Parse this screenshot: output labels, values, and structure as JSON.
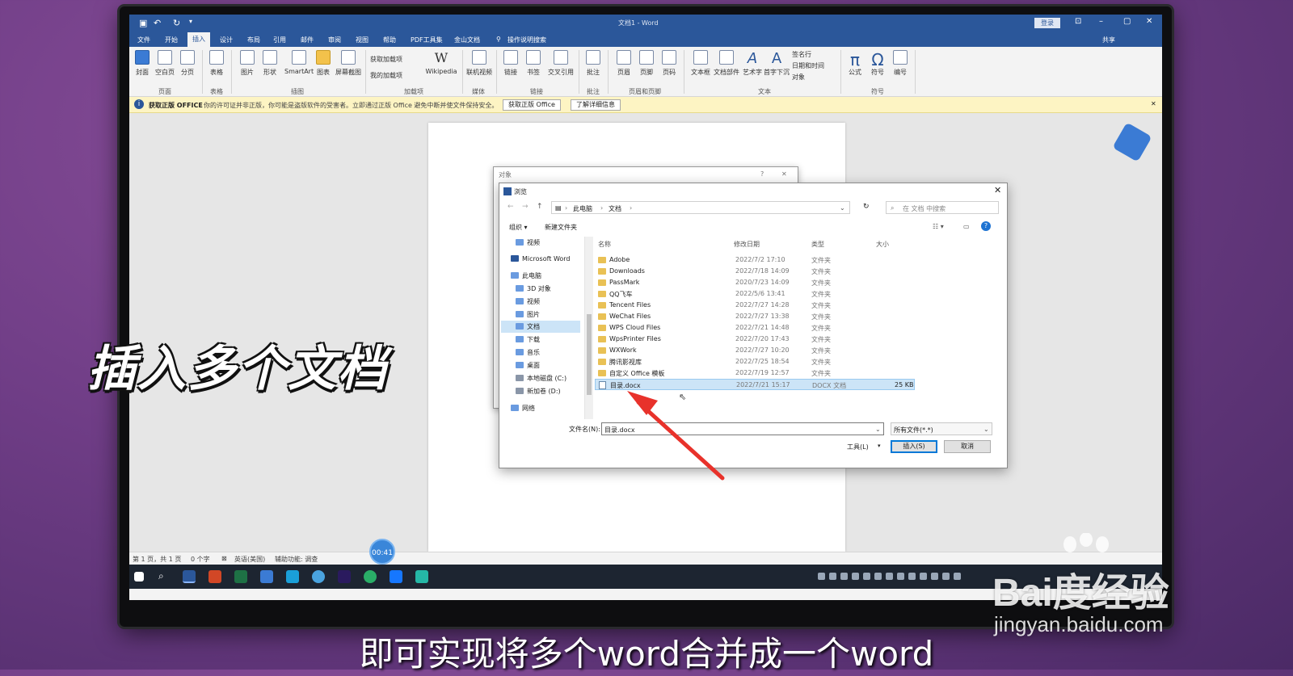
{
  "overlay": {
    "title": "插入多个文档",
    "subtitle": "即可实现将多个word合并成一个word",
    "watermark_brand": "Bai度经验",
    "watermark_url": "jingyan.baidu.com",
    "timer": "00:41"
  },
  "word": {
    "doc_title": "文档1 - Word",
    "login": "登录",
    "share": "共享",
    "tabs": [
      "文件",
      "开始",
      "插入",
      "设计",
      "布局",
      "引用",
      "邮件",
      "审阅",
      "视图",
      "帮助",
      "PDF工具集",
      "金山文档",
      "操作说明搜索"
    ],
    "ribbon": {
      "buttons": [
        "封面",
        "空白页",
        "分页",
        "表格",
        "图片",
        "形状",
        "SmartArt",
        "图表",
        "屏幕截图",
        "获取加载项",
        "我的加载项",
        "Wikipedia",
        "联机视频",
        "链接",
        "书签",
        "交叉引用",
        "批注",
        "页眉",
        "页脚",
        "页码",
        "文本框",
        "文档部件",
        "艺术字",
        "首字下沉",
        "签名行",
        "日期和时间",
        "对象",
        "公式",
        "符号",
        "编号"
      ],
      "groups": [
        "页面",
        "表格",
        "插图",
        "加载项",
        "媒体",
        "链接",
        "批注",
        "页眉和页脚",
        "文本",
        "符号"
      ]
    },
    "infobar": {
      "label": "获取正版 OFFICE",
      "message": "你的许可证并非正版，你可能是盗版软件的受害者。立即通过正版 Office 避免中断并使文件保持安全。",
      "btn1": "获取正版 Office",
      "btn2": "了解详细信息"
    },
    "status": {
      "page": "第 1 页，共 1 页",
      "words": "0 个字",
      "lang": "英语(美国)",
      "access": "辅助功能: 调查"
    }
  },
  "object_dialog": {
    "title": "对象"
  },
  "browse_dialog": {
    "title": "浏览",
    "path": [
      "此电脑",
      "文档"
    ],
    "search_placeholder": "在 文档 中搜索",
    "organize": "组织 ▾",
    "new_folder": "新建文件夹",
    "nav": [
      "视频",
      "Microsoft Word",
      "此电脑",
      "3D 对象",
      "视频",
      "图片",
      "文档",
      "下载",
      "音乐",
      "桌面",
      "本地磁盘 (C:)",
      "新加卷 (D:)",
      "网络"
    ],
    "columns": [
      "名称",
      "修改日期",
      "类型",
      "大小"
    ],
    "rows": [
      {
        "name": "Adobe",
        "date": "2022/7/2 17:10",
        "type": "文件夹",
        "size": ""
      },
      {
        "name": "Downloads",
        "date": "2022/7/18 14:09",
        "type": "文件夹",
        "size": ""
      },
      {
        "name": "PassMark",
        "date": "2020/7/23 14:09",
        "type": "文件夹",
        "size": ""
      },
      {
        "name": "QQ飞车",
        "date": "2022/5/6 13:41",
        "type": "文件夹",
        "size": ""
      },
      {
        "name": "Tencent Files",
        "date": "2022/7/27 14:28",
        "type": "文件夹",
        "size": ""
      },
      {
        "name": "WeChat Files",
        "date": "2022/7/27 13:38",
        "type": "文件夹",
        "size": ""
      },
      {
        "name": "WPS Cloud Files",
        "date": "2022/7/21 14:48",
        "type": "文件夹",
        "size": ""
      },
      {
        "name": "WpsPrinter Files",
        "date": "2022/7/20 17:43",
        "type": "文件夹",
        "size": ""
      },
      {
        "name": "WXWork",
        "date": "2022/7/27 10:20",
        "type": "文件夹",
        "size": ""
      },
      {
        "name": "腾讯影视库",
        "date": "2022/7/25 18:54",
        "type": "文件夹",
        "size": ""
      },
      {
        "name": "自定义 Office 模板",
        "date": "2022/7/19 12:57",
        "type": "文件夹",
        "size": ""
      },
      {
        "name": "目录.docx",
        "date": "2022/7/21 15:17",
        "type": "DOCX 文档",
        "size": "25 KB"
      }
    ],
    "filename_label": "文件名(N):",
    "filename_value": "目录.docx",
    "filetype": "所有文件(*.*)",
    "tools": "工具(L)",
    "insert": "插入(S)",
    "cancel": "取消"
  },
  "colors": {
    "word_blue": "#2b579a",
    "arrow": "#e8322b",
    "selection": "#cce4f7"
  }
}
